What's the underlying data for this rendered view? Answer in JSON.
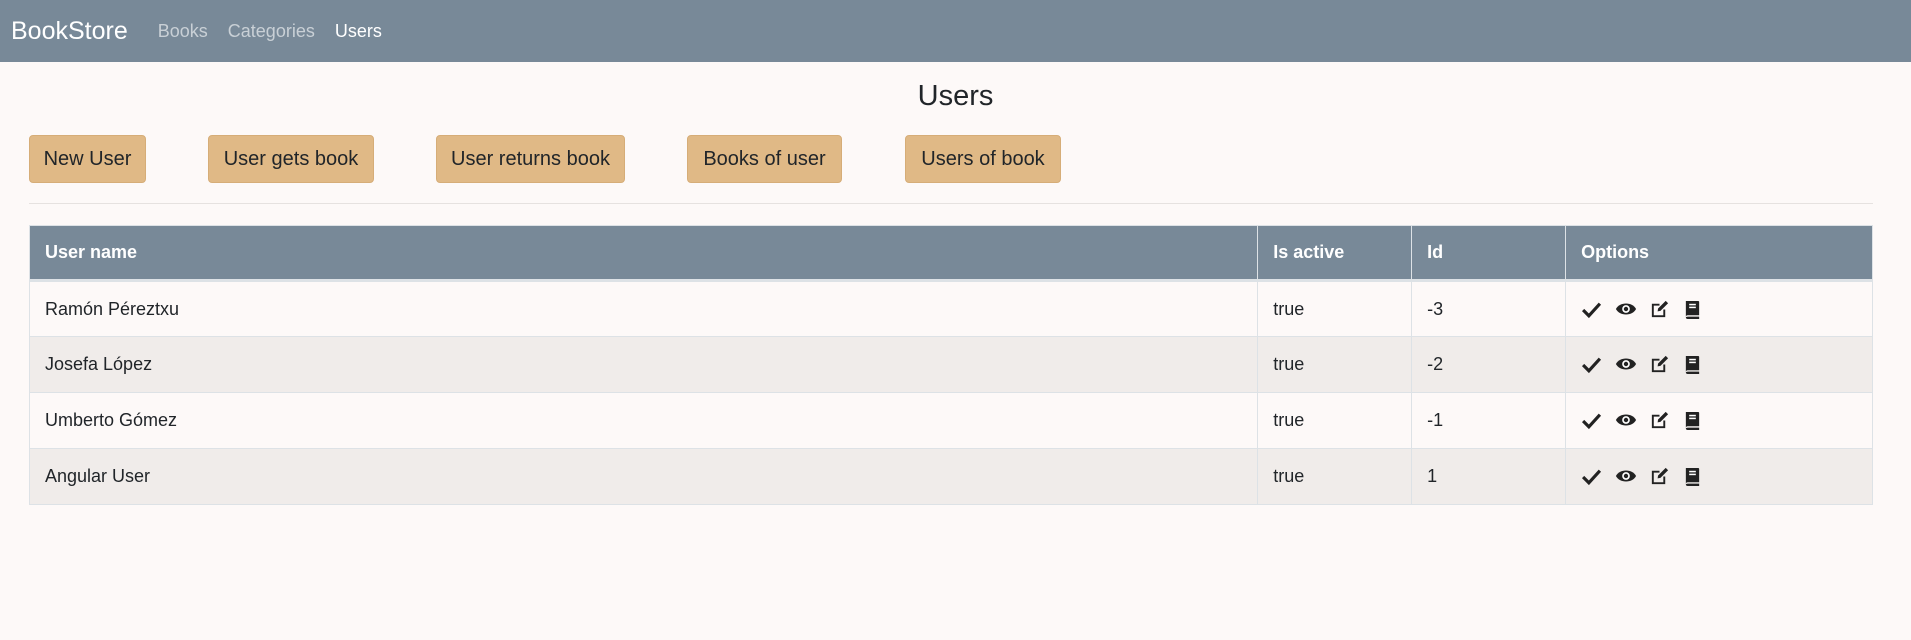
{
  "nav": {
    "brand": "BookStore",
    "links": [
      {
        "label": "Books"
      },
      {
        "label": "Categories"
      },
      {
        "label": "Users",
        "active": true
      }
    ]
  },
  "page": {
    "title": "Users"
  },
  "actions": {
    "new_user": "New User",
    "user_gets_book": "User gets book",
    "user_returns_book": "User returns book",
    "books_of_user": "Books of user",
    "users_of_book": "Users of book"
  },
  "table": {
    "headers": {
      "user_name": "User name",
      "is_active": "Is active",
      "id": "Id",
      "options": "Options"
    },
    "rows": [
      {
        "user_name": "Ramón Péreztxu",
        "is_active": "true",
        "id": "-3"
      },
      {
        "user_name": "Josefa López",
        "is_active": "true",
        "id": "-2"
      },
      {
        "user_name": "Umberto Gómez",
        "is_active": "true",
        "id": "-1"
      },
      {
        "user_name": "Angular User",
        "is_active": "true",
        "id": "1"
      }
    ],
    "row_option_icons": [
      "check-icon",
      "eye-icon",
      "edit-icon",
      "book-icon"
    ]
  },
  "colors": {
    "navbar": "#788998",
    "button": "#e0b986",
    "row_alt": "#f0ecea",
    "background": "#fdf9f8"
  }
}
